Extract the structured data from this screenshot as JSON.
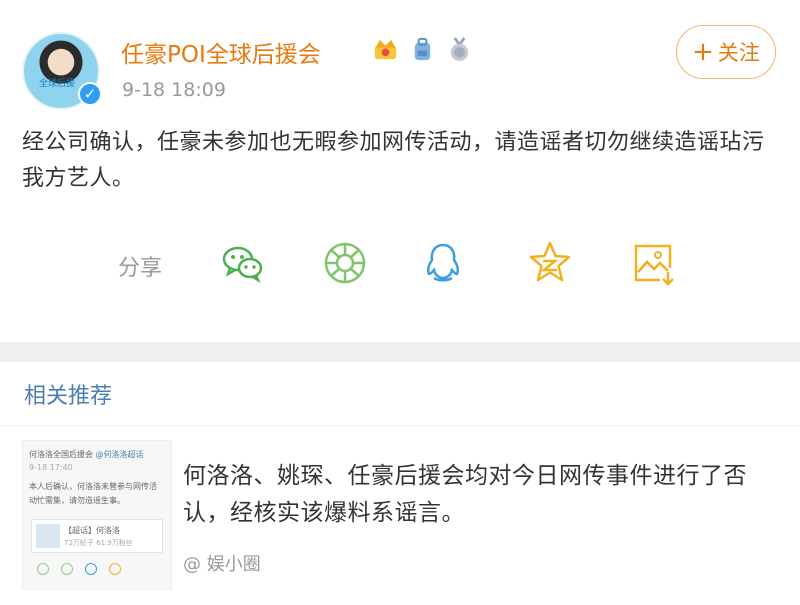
{
  "post": {
    "username": "任豪POI全球后援会",
    "avatar_caption": "全球后援",
    "timestamp": "9-18 18:09",
    "follow_label": "关注",
    "follow_plus": "+",
    "text": "经公司确认，任豪未参加也无暇参加网传活动，请造谣者切勿继续造谣玷污我方艺人。",
    "badges": [
      "crown-badge-icon",
      "backpack-badge-icon",
      "medal-badge-icon"
    ],
    "share": {
      "label": "分享",
      "targets": [
        "wechat-icon",
        "moments-icon",
        "qq-icon",
        "qzone-icon",
        "save-image-icon"
      ]
    }
  },
  "related": {
    "title": "相关推荐",
    "item": {
      "headline": "何洛洛、姚琛、任豪后援会均对今日网传事件进行了否认，经核实该爆料系谣言。",
      "source": "@ 娱小圈",
      "thumb": {
        "account": "何洛洛全国后援会",
        "tag": "@何洛洛超话",
        "time": "9-18 17:40",
        "body1": "本人后确认，何洛洛未曾参与网传活",
        "body2": "动忙需集，请勿造谣生事。",
        "card_title": "【超话】何洛洛",
        "card_meta": "72万帖子 61.9万粉丝"
      }
    }
  },
  "colors": {
    "username": "#e8790f",
    "link_blue": "#4a7fb0",
    "muted": "#999999",
    "wechat_green": "#4caf50",
    "qq_blue": "#3a9de0",
    "qzone_yellow": "#f2b01e"
  }
}
